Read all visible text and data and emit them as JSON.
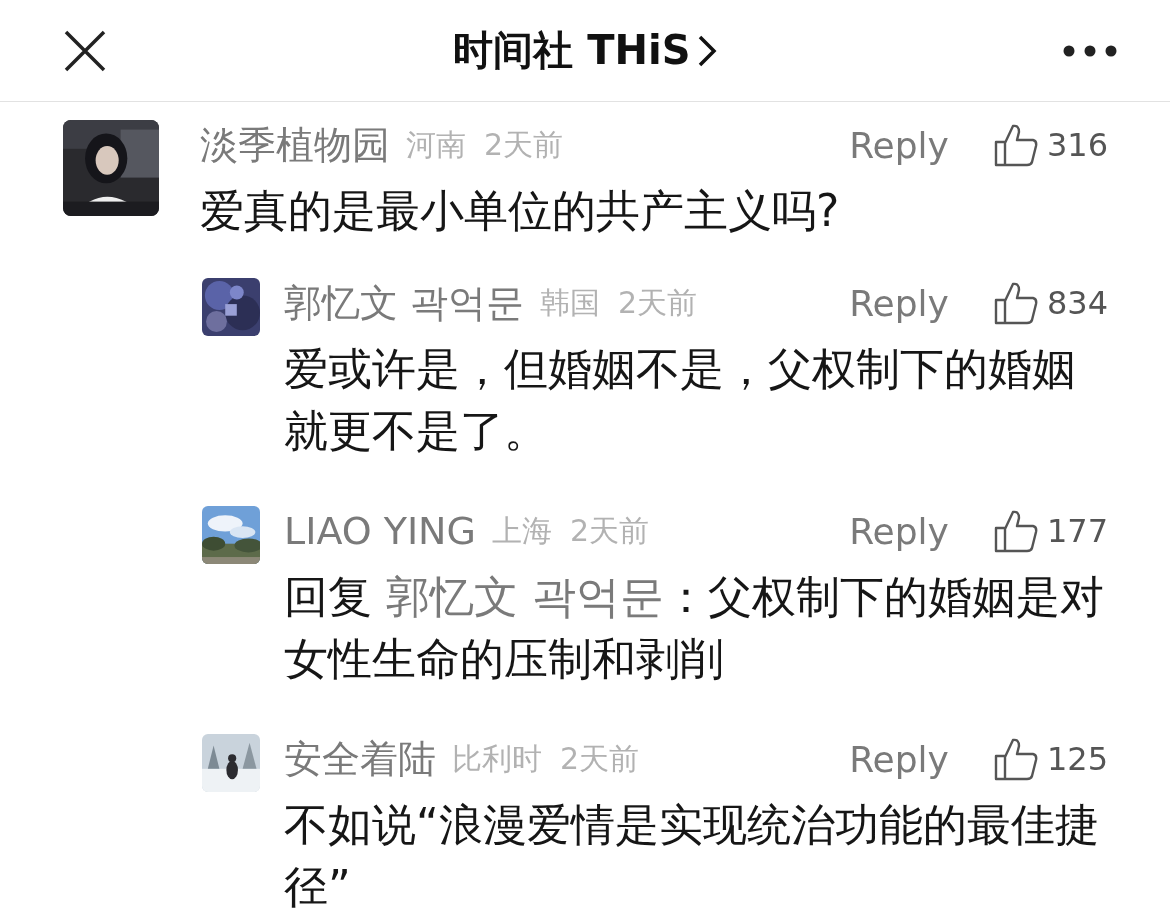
{
  "header": {
    "title": "时间社 THiS"
  },
  "comments": [
    {
      "author": "淡季植物园",
      "location": "河南",
      "time": "2天前",
      "reply_label": "Reply",
      "likes": "316",
      "text": "爱真的是最小单位的共产主义吗?",
      "replies": [
        {
          "author": "郭忆文 곽억문",
          "location": "韩国",
          "time": "2天前",
          "reply_label": "Reply",
          "likes": "834",
          "text": "爱或许是，但婚姻不是，父权制下的婚姻就更不是了。"
        },
        {
          "author": "LIAO YING",
          "location": "上海",
          "time": "2天前",
          "reply_label": "Reply",
          "likes": "177",
          "reply_prefix": "回复",
          "reply_to": "郭忆文 곽억문",
          "text": "：父权制下的婚姻是对女性生命的压制和剥削"
        },
        {
          "author": "安全着陆",
          "location": "比利时",
          "time": "2天前",
          "reply_label": "Reply",
          "likes": "125",
          "text": "不如说“浪漫爱情是实现统治功能的最佳捷径”"
        }
      ]
    }
  ]
}
